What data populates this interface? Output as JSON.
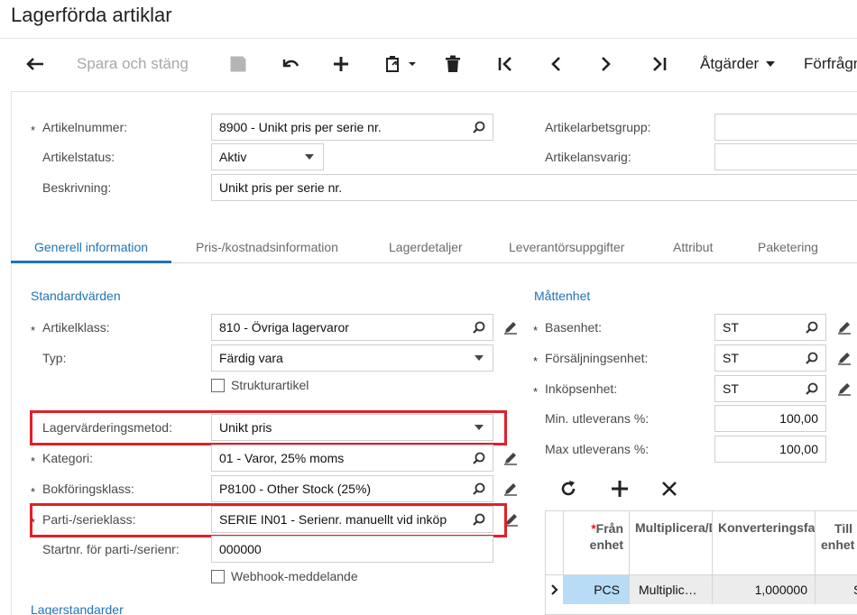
{
  "page_title": "Lagerförda artiklar",
  "toolbar": {
    "save_close": "Spara och stäng",
    "actions": "Åtgärder",
    "inquiries": "Förfrågningar"
  },
  "header": {
    "artikelnummer_label": "Artikelnummer:",
    "artikelnummer_value": "8900 - Unikt pris per serie nr.",
    "artikelstatus_label": "Artikelstatus:",
    "artikelstatus_value": "Aktiv",
    "beskrivning_label": "Beskrivning:",
    "beskrivning_value": "Unikt pris per serie nr.",
    "artikelarbetsgrupp_label": "Artikelarbetsgrupp:",
    "artikelarbetsgrupp_value": "",
    "artikelansvarig_label": "Artikelansvarig:",
    "artikelansvarig_value": ""
  },
  "tabs": [
    {
      "label": "Generell information",
      "active": true
    },
    {
      "label": "Pris-/kostnadsinformation"
    },
    {
      "label": "Lagerdetaljer"
    },
    {
      "label": "Leverantörsuppgifter"
    },
    {
      "label": "Attribut"
    },
    {
      "label": "Paketering"
    }
  ],
  "defaults": {
    "section_title": "Standardvärden",
    "artikelklass_label": "Artikelklass:",
    "artikelklass_value": "810 - Övriga lagervaror",
    "typ_label": "Typ:",
    "typ_value": "Färdig vara",
    "strukturartikel_label": "Strukturartikel",
    "strukturartikel_checked": false,
    "lagervardering_label": "Lagervärderingsmetod:",
    "lagervardering_value": "Unikt pris",
    "kategori_label": "Kategori:",
    "kategori_value": "01 - Varor, 25% moms",
    "bokforing_label": "Bokföringsklass:",
    "bokforing_value": "P8100 - Other Stock (25%)",
    "parti_label": "Parti-/serieklass:",
    "parti_value": "SERIE IN01 - Serienr. manuellt vid inköp",
    "startnr_label": "Startnr. för parti-/serienr:",
    "startnr_value": "000000",
    "webhook_label": "Webhook-meddelande",
    "webhook_checked": false,
    "next_section_title": "Lagerstandarder"
  },
  "units": {
    "section_title": "Måttenhet",
    "basenhet_label": "Basenhet:",
    "basenhet_value": "ST",
    "forsaljning_label": "Försäljningsenhet:",
    "forsaljning_value": "ST",
    "inkop_label": "Inköpsenhet:",
    "inkop_value": "ST",
    "min_label": "Min. utleverans %:",
    "min_value": "100,00",
    "max_label": "Max utleverans %:",
    "max_value": "100,00"
  },
  "grid": {
    "headers": {
      "from_unit_line1": "Från",
      "from_unit_line2": "enhet",
      "multiply": "Multiplicera/Dividera",
      "conversion": "Konverteringsfaktor",
      "to_unit_line1": "Till",
      "to_unit_line2": "enhet"
    },
    "rows": [
      {
        "from_unit": "PCS",
        "multiply": "Multiplic…",
        "conversion": "1,000000",
        "to_unit": "ST"
      }
    ]
  },
  "colors": {
    "accent": "#1f73b7",
    "highlight": "#e0202a"
  }
}
